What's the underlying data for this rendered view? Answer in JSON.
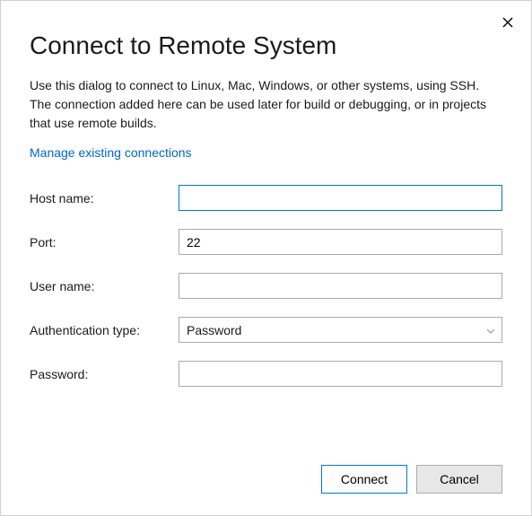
{
  "dialog": {
    "title": "Connect to Remote System",
    "description": "Use this dialog to connect to Linux, Mac, Windows, or other systems, using SSH. The connection added here can be used later for build or debugging, or in projects that use remote builds.",
    "link_label": "Manage existing connections"
  },
  "form": {
    "host_name": {
      "label": "Host name:",
      "value": ""
    },
    "port": {
      "label": "Port:",
      "value": "22"
    },
    "user_name": {
      "label": "User name:",
      "value": ""
    },
    "auth_type": {
      "label": "Authentication type:",
      "selected": "Password"
    },
    "password": {
      "label": "Password:",
      "value": ""
    }
  },
  "buttons": {
    "connect": "Connect",
    "cancel": "Cancel"
  }
}
